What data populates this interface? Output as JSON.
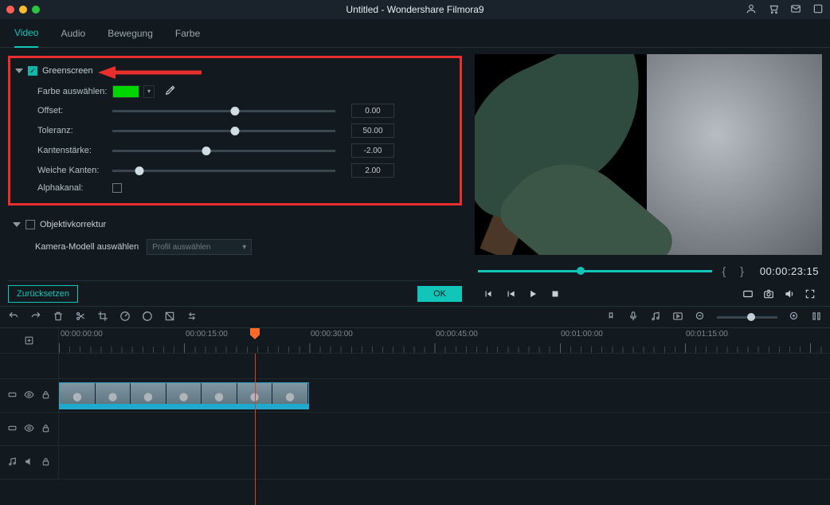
{
  "window": {
    "title": "Untitled - Wondershare Filmora9"
  },
  "tabs": {
    "video": "Video",
    "audio": "Audio",
    "motion": "Bewegung",
    "color": "Farbe"
  },
  "greenscreen": {
    "title": "Greenscreen",
    "selectColor": "Farbe auswählen:",
    "offset_label": "Offset:",
    "offset_value": "0.00",
    "tolerance_label": "Toleranz:",
    "tolerance_value": "50.00",
    "edge_label": "Kantenstärke:",
    "edge_value": "-2.00",
    "feather_label": "Weiche Kanten:",
    "feather_value": "2.00",
    "alpha_label": "Alphakanal:"
  },
  "lens": {
    "title": "Objektivkorrektur",
    "camera_label": "Kamera-Modell auswählen",
    "profile_placeholder": "Profil auswählen"
  },
  "buttons": {
    "reset": "Zurücksetzen",
    "ok": "OK"
  },
  "preview": {
    "timecode": "00:00:23:15"
  },
  "ruler": {
    "t0": "00:00:00:00",
    "t1": "00:00:15:00",
    "t2": "00:00:30:00",
    "t3": "00:00:45:00",
    "t4": "00:01:00:00",
    "t5": "00:01:15:00"
  }
}
